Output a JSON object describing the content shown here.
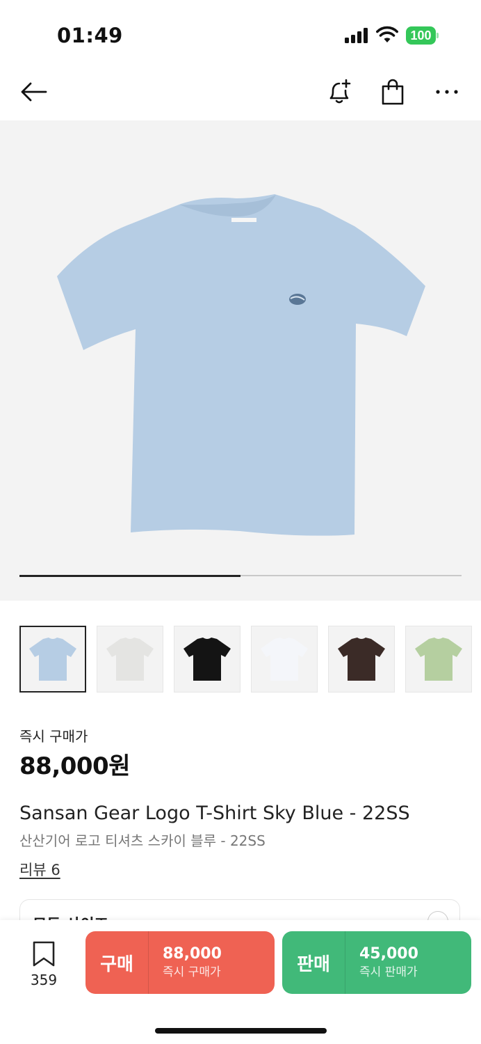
{
  "status_bar": {
    "time": "01:49",
    "battery": "100"
  },
  "colors": {
    "buy": "#ef6253",
    "sell": "#41b979",
    "battery": "#34c759",
    "product_sky_blue": "#b6cde4"
  },
  "nav": {
    "icons": [
      "back-arrow-icon",
      "bell-plus-icon",
      "shopping-bag-icon",
      "more-icon"
    ]
  },
  "gallery": {
    "progress": 0.5
  },
  "thumbnails": [
    {
      "name": "sky-blue",
      "color": "#b6cde4"
    },
    {
      "name": "white-gray",
      "color": "#e4e4e2"
    },
    {
      "name": "black",
      "color": "#141414"
    },
    {
      "name": "white",
      "color": "#f4f6fa"
    },
    {
      "name": "brown",
      "color": "#3b2b27"
    },
    {
      "name": "green",
      "color": "#b5cfa0"
    }
  ],
  "product": {
    "price_label": "즉시 구매가",
    "price": "88,000원",
    "title_en": "Sansan Gear Logo T-Shirt Sky Blue - 22SS",
    "title_ko": "산산기어 로고 티셔츠 스카이 블루 - 22SS",
    "review": "리뷰 6",
    "size_label": "모든 사이즈"
  },
  "bottom_bar": {
    "bookmark_count": "359",
    "buy": {
      "label": "구매",
      "amount": "88,000",
      "sub": "즉시 구매가"
    },
    "sell": {
      "label": "판매",
      "amount": "45,000",
      "sub": "즉시 판매가"
    }
  }
}
